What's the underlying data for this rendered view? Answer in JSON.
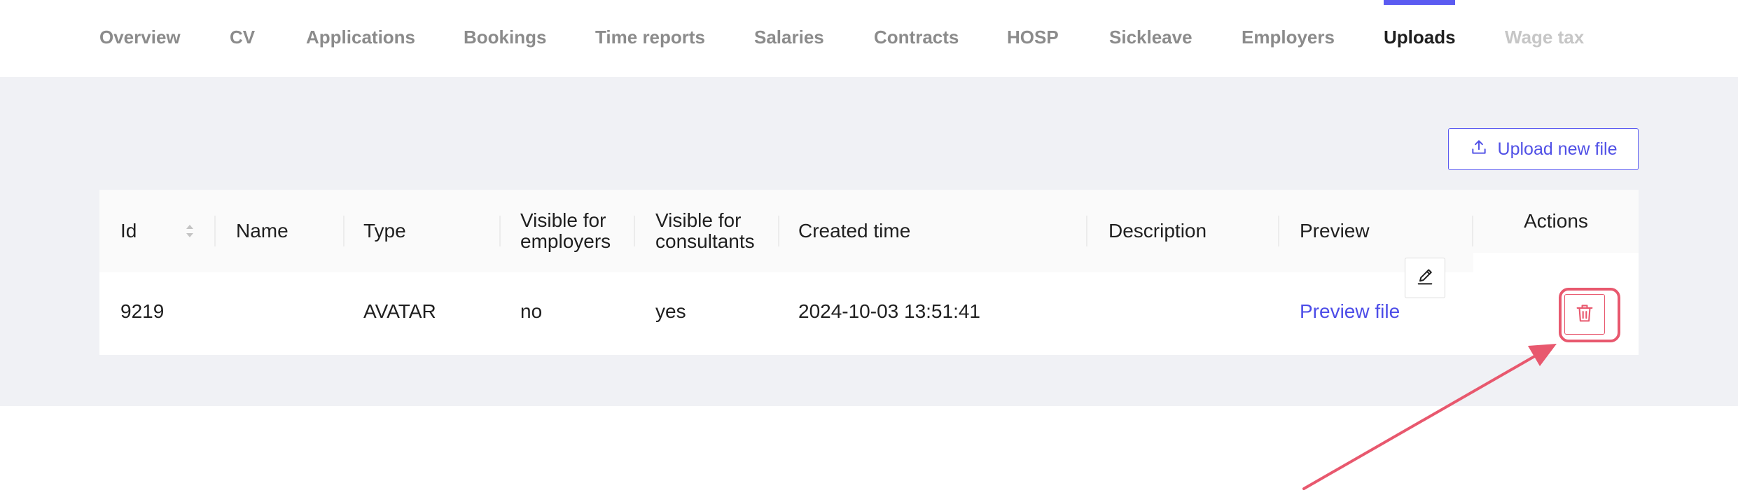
{
  "tabs": [
    {
      "label": "Overview",
      "state": "inactive"
    },
    {
      "label": "CV",
      "state": "inactive"
    },
    {
      "label": "Applications",
      "state": "inactive"
    },
    {
      "label": "Bookings",
      "state": "inactive"
    },
    {
      "label": "Time reports",
      "state": "inactive"
    },
    {
      "label": "Salaries",
      "state": "inactive"
    },
    {
      "label": "Contracts",
      "state": "inactive"
    },
    {
      "label": "HOSP",
      "state": "inactive"
    },
    {
      "label": "Sickleave",
      "state": "inactive"
    },
    {
      "label": "Employers",
      "state": "inactive"
    },
    {
      "label": "Uploads",
      "state": "active"
    },
    {
      "label": "Wage tax",
      "state": "disabled"
    }
  ],
  "toolbar": {
    "upload_label": "Upload new file",
    "upload_icon": "upload-icon"
  },
  "table": {
    "columns": {
      "id": "Id",
      "name": "Name",
      "type": "Type",
      "visible_employers": [
        "Visible for",
        "employers"
      ],
      "visible_consultants": [
        "Visible for",
        "consultants"
      ],
      "created_time": "Created time",
      "description": "Description",
      "preview": "Preview",
      "actions": "Actions"
    },
    "rows": [
      {
        "id": "9219",
        "name": "",
        "type": "AVATAR",
        "visible_employers": "no",
        "visible_consultants": "yes",
        "created_time": "2024-10-03 13:51:41",
        "description": "",
        "preview": "Preview file",
        "actions": [
          "pencil-icon",
          "trash-icon"
        ]
      }
    ]
  },
  "annotation": {
    "type": "arrow",
    "target": "delete-button",
    "color": "#e8586e"
  },
  "colors": {
    "accent": "#5b5bf1",
    "link": "#4d4de8",
    "danger": "#e8586e",
    "content_background": "#f0f1f5"
  }
}
